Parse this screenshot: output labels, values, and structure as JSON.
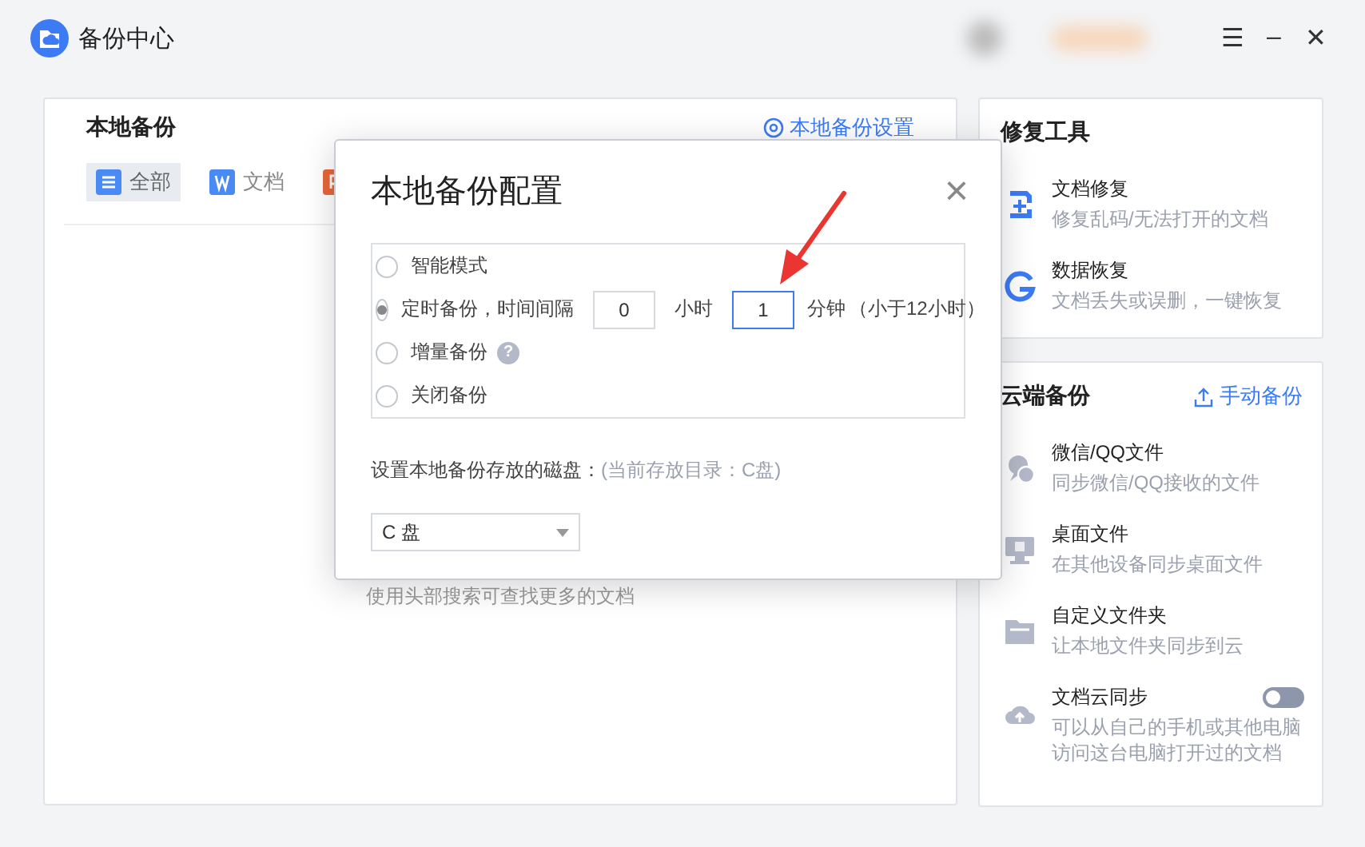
{
  "window": {
    "title": "备份中心",
    "controls": [
      "☰",
      "–",
      "✕"
    ]
  },
  "local_backup": {
    "title": "本地备份",
    "settings_link": "本地备份设置",
    "tabs": [
      {
        "label": "全部",
        "kind": "all",
        "selected": true
      },
      {
        "label": "文档",
        "kind": "word",
        "selected": false
      },
      {
        "kind": "slides",
        "selected": false
      }
    ],
    "hint": "使用头部搜索可查找更多的文档"
  },
  "repair_tools": {
    "title": "修复工具",
    "items": [
      {
        "kind": "doc-repair",
        "title": "文档修复",
        "description": "修复乱码/无法打开的文档"
      },
      {
        "kind": "data-recovery",
        "title": "数据恢复",
        "description": "文档丢失或误删，一键恢复"
      }
    ]
  },
  "cloud_backup": {
    "title": "云端备份",
    "action": "手动备份",
    "items": [
      {
        "kind": "chat",
        "title": "微信/QQ文件",
        "description": "同步微信/QQ接收的文件"
      },
      {
        "kind": "desktop",
        "title": "桌面文件",
        "description": "在其他设备同步桌面文件"
      },
      {
        "kind": "folder",
        "title": "自定义文件夹",
        "description": "让本地文件夹同步到云"
      },
      {
        "kind": "cloud",
        "title": "文档云同步",
        "description": "可以从自己的手机或其他电脑访问这台电脑打开过的文档",
        "toggle": {
          "on": false
        }
      }
    ]
  },
  "dialog": {
    "title": "本地备份配置",
    "close": "×",
    "options": [
      {
        "kind": "plain",
        "label": "智能模式",
        "selected": false
      },
      {
        "kind": "interval",
        "label": "定时备份，时间间隔",
        "selected": true,
        "hours": {
          "value": "0",
          "focused": false
        },
        "hours_unit": "小时",
        "minutes": {
          "value": "1",
          "focused": true
        },
        "minutes_unit": "分钟",
        "note": "（小于12小时）"
      },
      {
        "kind": "help",
        "label": "增量备份",
        "help": "?",
        "selected": false
      },
      {
        "kind": "plain",
        "label": "关闭备份",
        "selected": false
      }
    ],
    "disk_label": "设置本地备份存放的磁盘：",
    "disk_note": "(当前存放目录：C盘)",
    "disk_select": {
      "value": "C 盘"
    }
  }
}
